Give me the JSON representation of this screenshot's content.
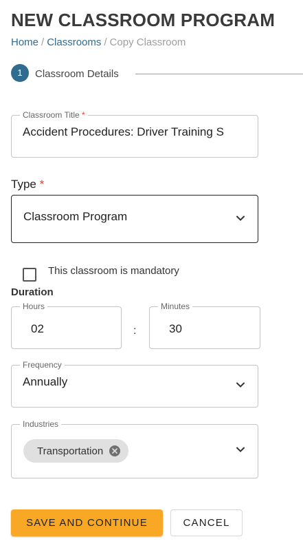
{
  "header": {
    "title": "NEW CLASSROOM PROGRAM"
  },
  "breadcrumb": {
    "items": [
      "Home",
      "Classrooms"
    ],
    "separator": "/",
    "current": "Copy Classroom"
  },
  "stepper": {
    "step_number": "1",
    "step_label": "Classroom Details"
  },
  "form": {
    "classroom_title": {
      "label": "Classroom Title",
      "required_mark": "*",
      "value": "Accident Procedures: Driver Training S"
    },
    "type": {
      "label": "Type",
      "required_mark": "*",
      "value": "Classroom Program"
    },
    "mandatory": {
      "label": "This classroom is mandatory",
      "checked": false
    },
    "duration": {
      "label": "Duration",
      "hours_label": "Hours",
      "hours_value": "02",
      "separator": ":",
      "minutes_label": "Minutes",
      "minutes_value": "30"
    },
    "frequency": {
      "label": "Frequency",
      "value": "Annually"
    },
    "industries": {
      "label": "Industries",
      "chips": [
        "Transportation"
      ]
    }
  },
  "actions": {
    "save_label": "SAVE AND CONTINUE",
    "cancel_label": "CANCEL"
  },
  "colors": {
    "accent": "#2f6c8f",
    "primary_button": "#f9a825",
    "required": "#e53935",
    "chip_bg": "#e0e0e0"
  },
  "icons": [
    "chevron-down-icon",
    "chip-remove-icon"
  ]
}
